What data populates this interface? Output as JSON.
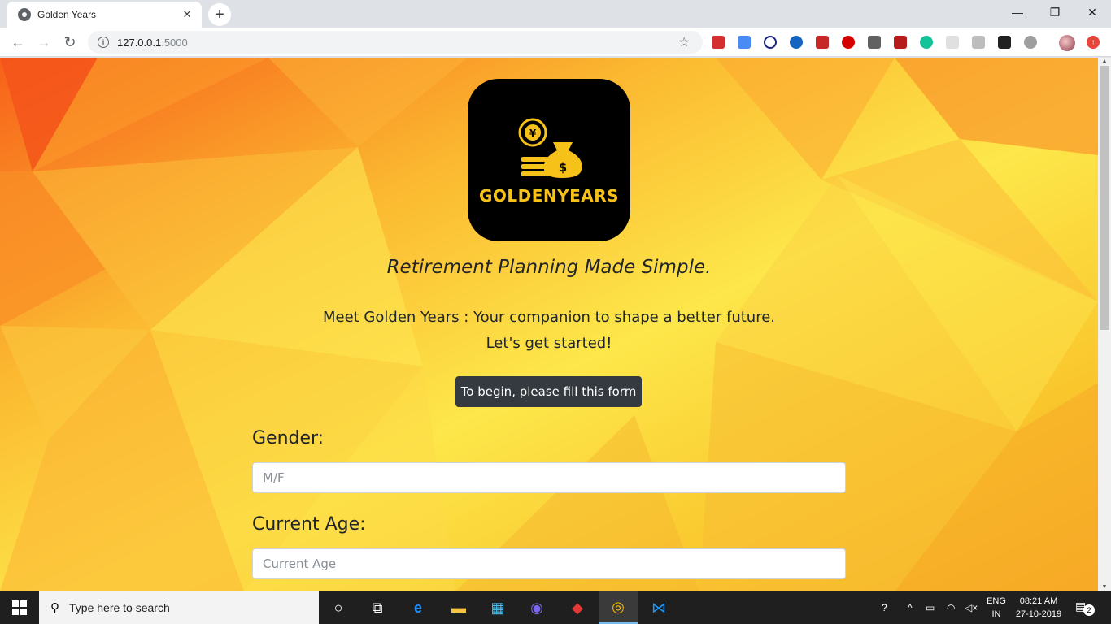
{
  "browser": {
    "tab_title": "Golden Years",
    "url_host": "127.0.0.1",
    "url_port": ":5000"
  },
  "page": {
    "logo_text": "GOLDENYEARS",
    "tagline": "Retirement Planning Made Simple.",
    "intro_line1": "Meet Golden Years : Your companion to shape a better future.",
    "intro_line2": "Let's get started!",
    "begin_button": "To begin, please fill this form",
    "form": {
      "gender_label": "Gender:",
      "gender_placeholder": "M/F",
      "age_label": "Current Age:",
      "age_placeholder": "Current Age"
    },
    "colors": {
      "accent_gold": "#f6c21a",
      "button_dark": "#343a40"
    }
  },
  "taskbar": {
    "search_placeholder": "Type here to search",
    "lang_line1": "ENG",
    "lang_line2": "IN",
    "time": "08:21 AM",
    "date": "27-10-2019",
    "notification_count": "2"
  }
}
